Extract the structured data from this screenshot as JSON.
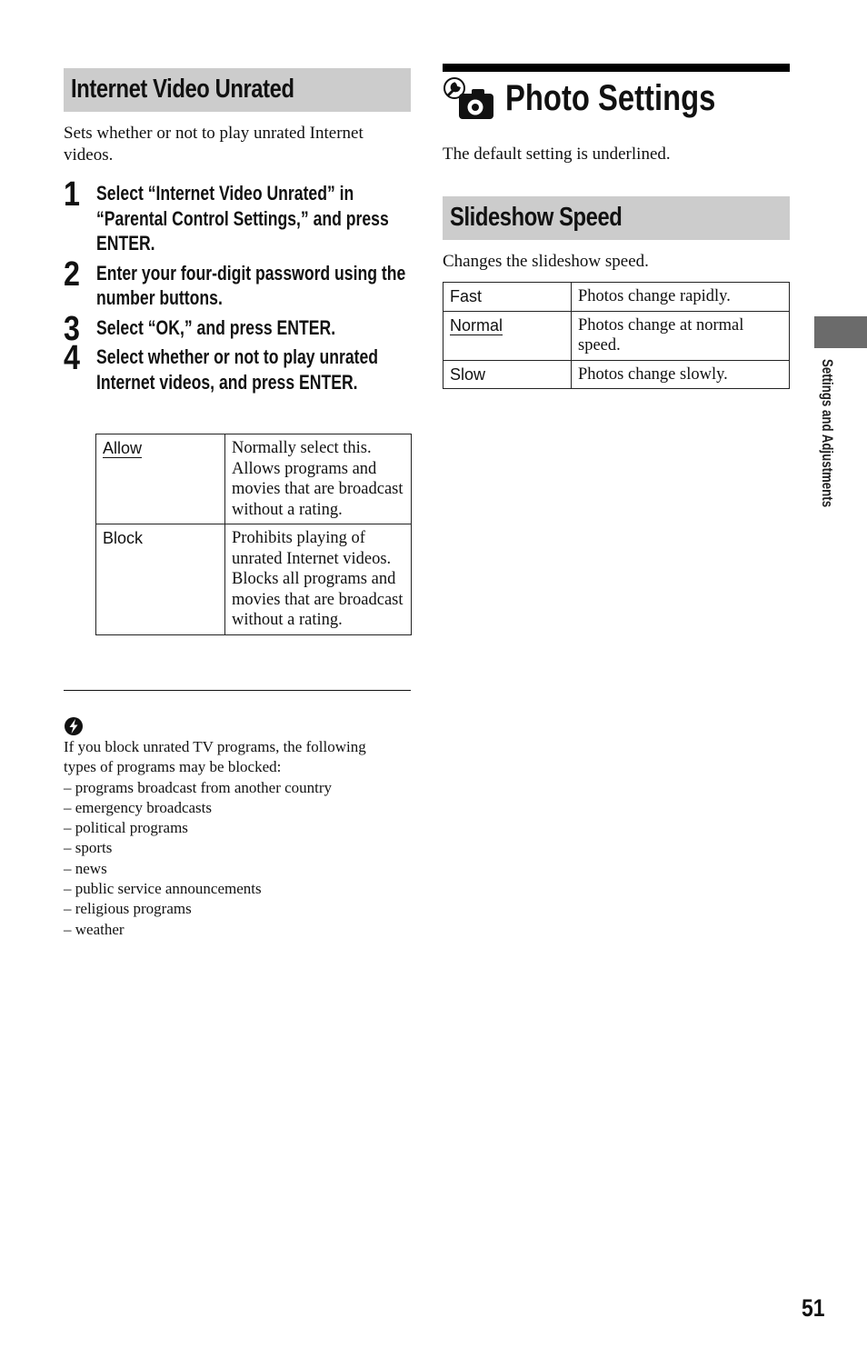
{
  "left": {
    "section_title": "Internet Video Unrated",
    "intro": "Sets whether or not to play unrated Internet videos.",
    "steps": [
      {
        "number": "1",
        "text": "Select “Internet Video Unrated” in “Parental Control Settings,” and press ENTER."
      },
      {
        "number": "2",
        "text": "Enter your four-digit password using the number buttons."
      },
      {
        "number": "3",
        "text": "Select “OK,” and press ENTER."
      },
      {
        "number": "4",
        "text": "Select whether or not to play unrated Internet videos, and press ENTER."
      }
    ],
    "options": [
      {
        "key": "Allow",
        "default": true,
        "desc": "Normally select this. Allows programs and movies that are broadcast without a rating."
      },
      {
        "key": "Block",
        "default": false,
        "desc": "Prohibits playing of unrated Internet videos. Blocks all programs and movies that are broadcast without a rating."
      }
    ],
    "note": {
      "icon": "hint-lightning-icon",
      "lines": [
        "If you block unrated TV programs, the following",
        "types of programs may be blocked:",
        "– programs broadcast from another country",
        "– emergency broadcasts",
        "– political programs",
        "– sports",
        "– news",
        "– public service announcements",
        "– religious programs",
        "– weather"
      ]
    }
  },
  "right": {
    "page_title": "Photo Settings",
    "title_icon": "photo-settings-icon",
    "default_note": "The default setting is underlined.",
    "section_title": "Slideshow Speed",
    "intro": "Changes the slideshow speed.",
    "options": [
      {
        "key": "Fast",
        "default": false,
        "desc": "Photos change rapidly."
      },
      {
        "key": "Normal",
        "default": true,
        "desc": "Photos change at normal speed."
      },
      {
        "key": "Slow",
        "default": false,
        "desc": "Photos change slowly."
      }
    ]
  },
  "side_label": "Settings and Adjustments",
  "page_number": "51"
}
